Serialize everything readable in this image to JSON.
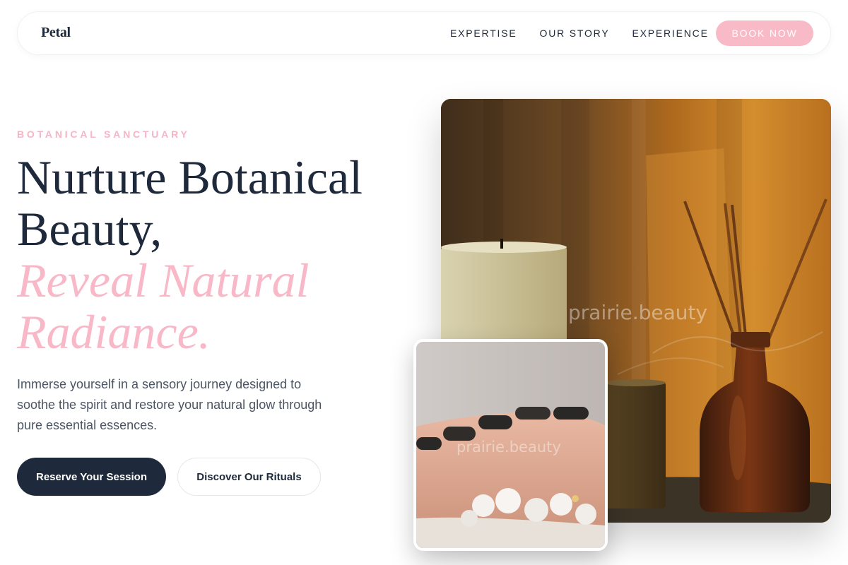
{
  "brand": {
    "name": "Petal"
  },
  "nav": {
    "links": [
      "EXPERTISE",
      "OUR STORY",
      "EXPERIENCE"
    ],
    "cta": "BOOK NOW"
  },
  "hero": {
    "eyebrow": "BOTANICAL SANCTUARY",
    "headline_line1": "Nurture Botanical",
    "headline_line2": "Beauty,",
    "headline_accent_line1": "Reveal Natural",
    "headline_accent_line2": "Radiance.",
    "description": "Immerse yourself in a sensory journey designed to soothe the spirit and restore your natural glow through pure essential essences.",
    "primary_button": "Reserve Your Session",
    "secondary_button": "Discover Our Rituals"
  },
  "images": {
    "main_watermark": "prairie.beauty",
    "small_watermark": "prairie.beauty"
  },
  "colors": {
    "accent_pink": "#f9b8c8",
    "navy": "#1e293b",
    "body_text": "#4b5563"
  }
}
